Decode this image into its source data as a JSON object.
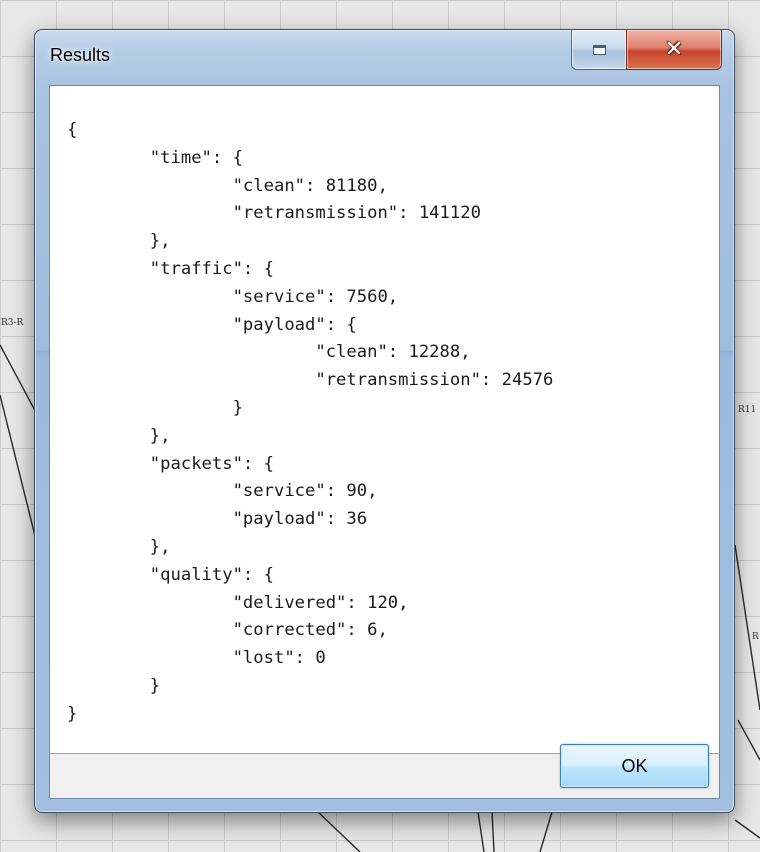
{
  "window": {
    "title": "Results"
  },
  "results_text": "{\n\t\"time\": {\n\t\t\"clean\": 81180,\n\t\t\"retransmission\": 141120\n\t},\n\t\"traffic\": {\n\t\t\"service\": 7560,\n\t\t\"payload\": {\n\t\t\t\"clean\": 12288,\n\t\t\t\"retransmission\": 24576\n\t\t}\n\t},\n\t\"packets\": {\n\t\t\"service\": 90,\n\t\t\"payload\": 36\n\t},\n\t\"quality\": {\n\t\t\"delivered\": 120,\n\t\t\"corrected\": 6,\n\t\t\"lost\": 0\n\t}\n}",
  "buttons": {
    "ok_label": "OK"
  },
  "background": {
    "left_tag": "R3-R",
    "right_tag": "R11",
    "right_tag_2": "R"
  },
  "icons": {
    "restore": "restore-icon",
    "close": "close-icon"
  },
  "colors": {
    "title_bar": "#a9c3e1",
    "close_button": "#c8442c",
    "ok_button": "#bee6fd",
    "ok_border": "#3c7fb1"
  }
}
